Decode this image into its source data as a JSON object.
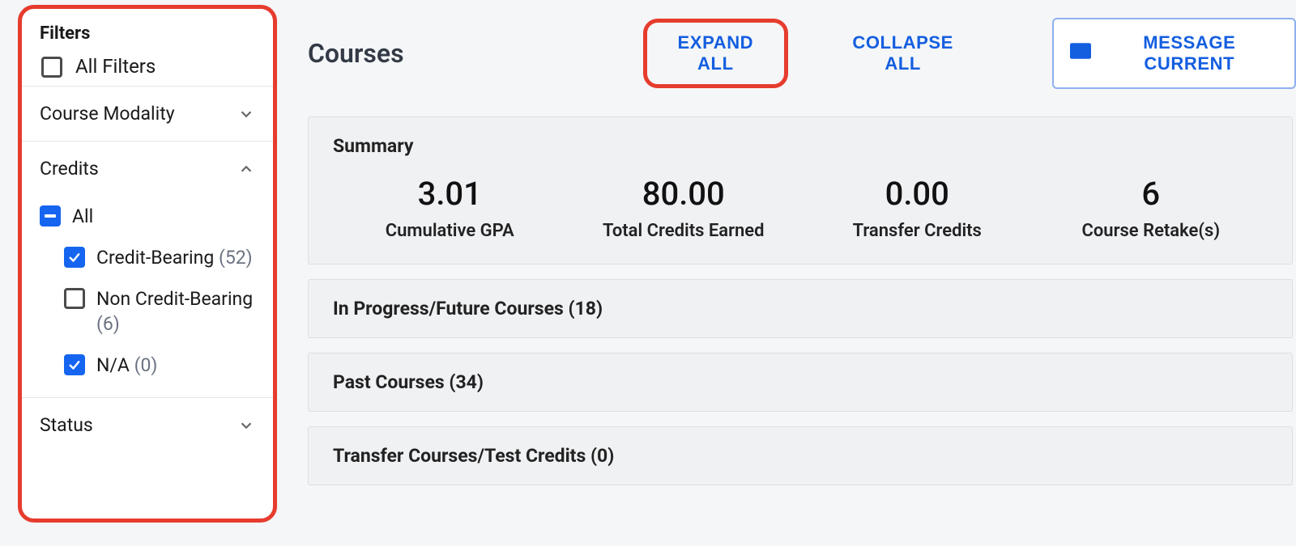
{
  "sidebar": {
    "filters_title": "Filters",
    "all_filters_label": "All Filters",
    "groups": {
      "modality": {
        "label": "Course Modality"
      },
      "credits": {
        "label": "Credits",
        "all_label": "All",
        "credit_bearing_label": "Credit-Bearing",
        "credit_bearing_count": "(52)",
        "non_credit_label": "Non Credit-Bearing",
        "non_credit_count": "(6)",
        "na_label": "N/A",
        "na_count": "(0)"
      },
      "status": {
        "label": "Status"
      }
    }
  },
  "header": {
    "title": "Courses",
    "expand_all": "EXPAND ALL",
    "collapse_all": "COLLAPSE ALL",
    "message_button": "MESSAGE CURRENT"
  },
  "summary": {
    "title": "Summary",
    "stats": [
      {
        "value": "3.01",
        "label": "Cumulative GPA"
      },
      {
        "value": "80.00",
        "label": "Total Credits Earned"
      },
      {
        "value": "0.00",
        "label": "Transfer Credits"
      },
      {
        "value": "6",
        "label": "Course Retake(s)"
      }
    ]
  },
  "sections": {
    "in_progress": "In Progress/Future Courses (18)",
    "past": "Past Courses (34)",
    "transfer": "Transfer Courses/Test Credits (0)"
  }
}
